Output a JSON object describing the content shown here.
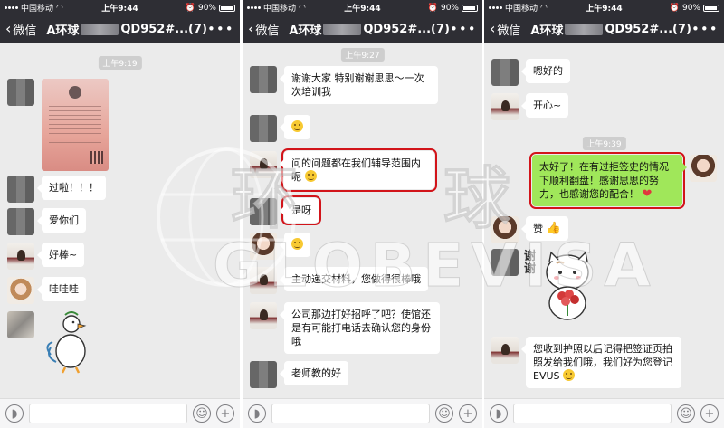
{
  "status": {
    "carrier": "中国移动",
    "time": "上午9:44",
    "battery": "90%"
  },
  "nav": {
    "back_label": "微信",
    "title_prefix": "A环球",
    "title_suffix": "QD952#...(7)",
    "more_label": "•••"
  },
  "watermark": {
    "text_cn_1": "环",
    "text_cn_2": "球",
    "text_en": "GLOBEVISA"
  },
  "screens": [
    {
      "time_chip": "上午9:19",
      "messages": [
        {
          "text": "过啦！！！"
        },
        {
          "text": "爱你们"
        },
        {
          "text": "好棒~"
        },
        {
          "text": "哇哇哇"
        }
      ]
    },
    {
      "time_chip": "上午9:27",
      "messages": [
        {
          "text": "谢谢大家 特别谢谢思思～一次次培训我"
        },
        {
          "text": "问的问题都在我们辅导范围内呢"
        },
        {
          "text": "是呀"
        },
        {
          "text": "主动递交材料，您做得很棒哦"
        },
        {
          "text": "公司那边打好招呼了吧？使馆还是有可能打电话去确认您的身份哦"
        },
        {
          "text": "老师教的好"
        }
      ]
    },
    {
      "time_chip": "上午9:39",
      "messages": [
        {
          "text": "嗯好的"
        },
        {
          "text": "开心~"
        },
        {
          "text": "太好了！在有过拒签史的情况下顺利翻盘！感谢思思的努力，也感谢您的配合！"
        },
        {
          "text": "赞"
        },
        {
          "text": "您收到护照以后记得把签证页拍照发给我们哦，我们好为您登记EVUS"
        }
      ],
      "sticker_text": "谢谢"
    }
  ],
  "colors": {
    "nav_bg": "#2e2e34",
    "chat_bg": "#ebebeb",
    "sent_bubble": "#a0e75a",
    "highlight": "#d2141a"
  }
}
